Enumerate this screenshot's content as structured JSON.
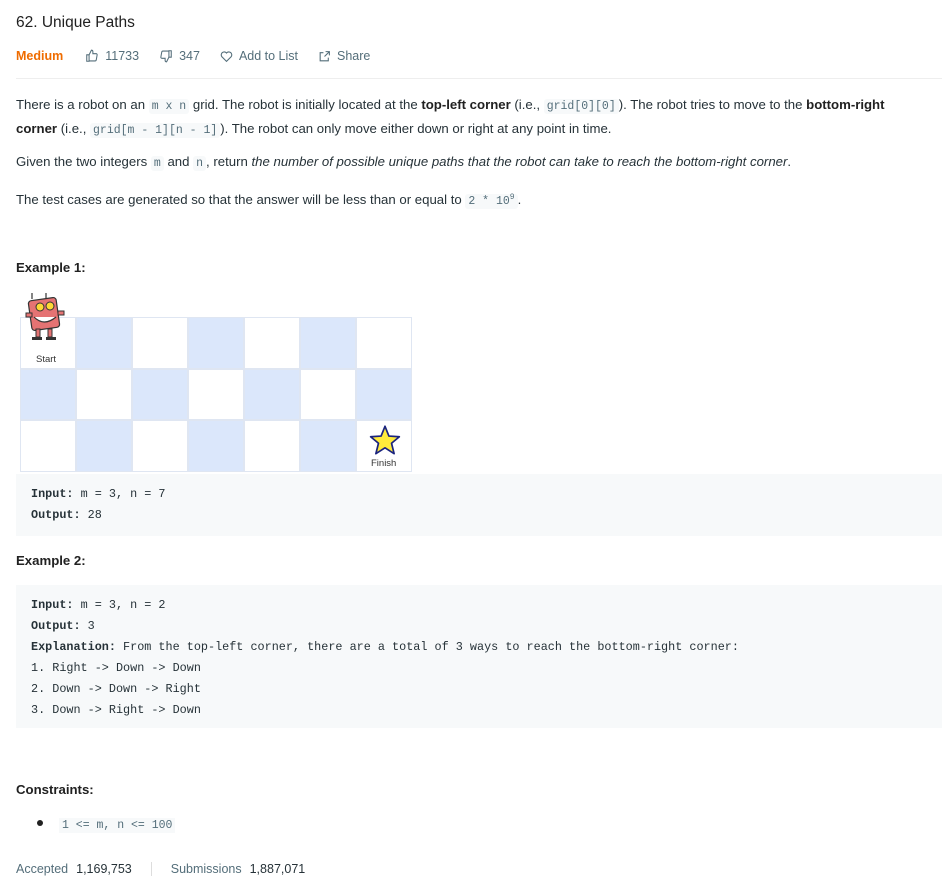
{
  "problem": {
    "title": "62. Unique Paths",
    "difficulty": "Medium",
    "likes": "11733",
    "dislikes": "347",
    "add_to_list": "Add to List",
    "share": "Share"
  },
  "description": {
    "p1_a": "There is a robot on an ",
    "p1_code1": "m x n",
    "p1_b": " grid. The robot is initially located at the ",
    "p1_bold1": "top-left corner",
    "p1_c": " (i.e., ",
    "p1_code2": "grid[0][0]",
    "p1_d": "). The robot tries to move to the ",
    "p1_bold2": "bottom-right corner",
    "p1_e": " (i.e., ",
    "p1_code3": "grid[m - 1][n - 1]",
    "p1_f": "). The robot can only move either down or right at any point in time.",
    "p2_a": "Given the two integers ",
    "p2_code1": "m",
    "p2_b": " and ",
    "p2_code2": "n",
    "p2_c": ", return ",
    "p2_ital": "the number of possible unique paths that the robot can take to reach the bottom-right corner",
    "p2_d": ".",
    "p3_a": "The test cases are generated so that the answer will be less than or equal to ",
    "p3_code_base": "2 * 10",
    "p3_code_exp": "9",
    "p3_b": "."
  },
  "example1": {
    "title": "Example 1:",
    "grid_start": "Start",
    "grid_finish": "Finish",
    "input_label": "Input:",
    "input_value": " m = 3, n = 7",
    "output_label": "Output:",
    "output_value": " 28"
  },
  "example2": {
    "title": "Example 2:",
    "input_label": "Input:",
    "input_value": " m = 3, n = 2",
    "output_label": "Output:",
    "output_value": " 3",
    "explanation_label": "Explanation:",
    "explanation_value": " From the top-left corner, there are a total of 3 ways to reach the bottom-right corner:",
    "steps": [
      "1. Right -> Down -> Down",
      "2. Down -> Down -> Right",
      "3. Down -> Right -> Down"
    ]
  },
  "constraints": {
    "title": "Constraints:",
    "items": [
      "1 <= m, n <= 100"
    ]
  },
  "stats": {
    "accepted_label": "Accepted",
    "accepted_value": "1,169,753",
    "submissions_label": "Submissions",
    "submissions_value": "1,887,071"
  },
  "colors": {
    "difficulty_medium": "#ef6c00",
    "grid_blue": "#dbe7fb",
    "code_bg": "#f7f9fa"
  },
  "icons": [
    "thumbs-up-icon",
    "thumbs-down-icon",
    "heart-icon",
    "share-icon",
    "robot-icon",
    "star-icon"
  ]
}
